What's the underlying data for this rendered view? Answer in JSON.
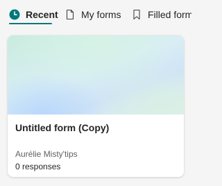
{
  "tabs": [
    {
      "label": "Recent",
      "icon": "clock-icon",
      "selected": true
    },
    {
      "label": "My forms",
      "icon": "document-icon",
      "selected": false
    },
    {
      "label": "Filled forms",
      "icon": "bookmark-icon",
      "selected": false
    }
  ],
  "colors": {
    "accent": "#03787c",
    "card_background": "#ffffff",
    "page_background": "#f5f5f5"
  },
  "card": {
    "title": "Untitled form (Copy)",
    "owner": "Aurélie Misty'tips",
    "responses": "0 responses"
  }
}
